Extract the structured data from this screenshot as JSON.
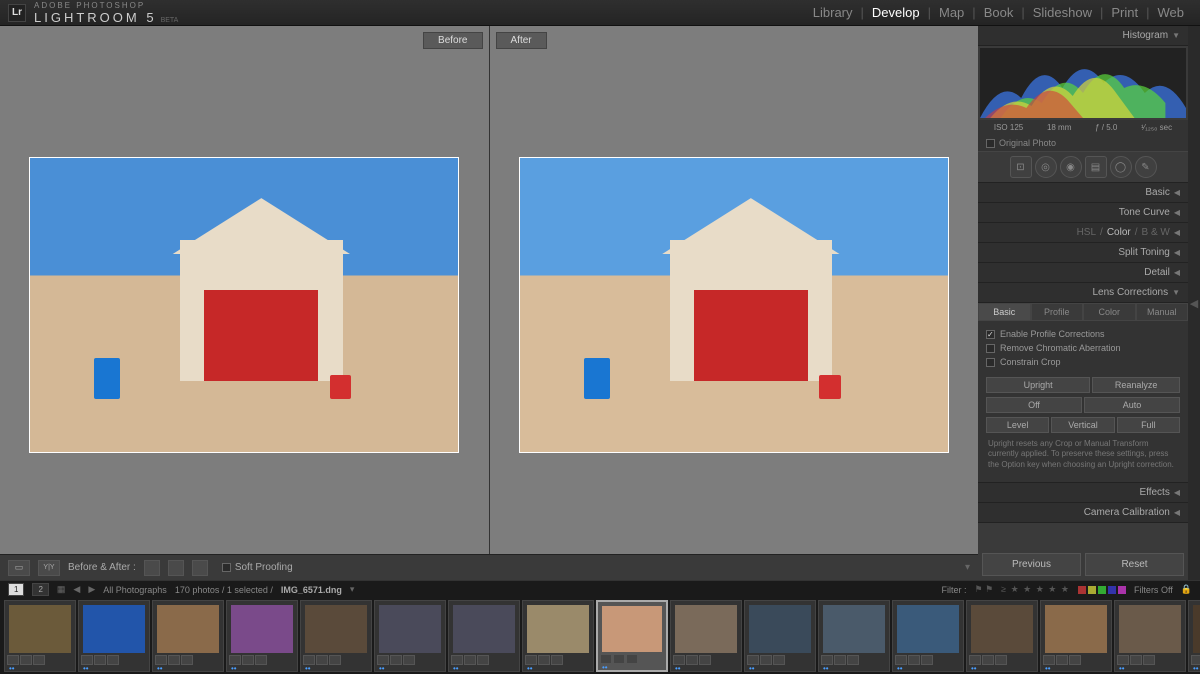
{
  "brand": {
    "small": "ADOBE PHOTOSHOP",
    "big": "LIGHTROOM 5",
    "beta": "BETA",
    "logo": "Lr"
  },
  "modules": [
    "Library",
    "Develop",
    "Map",
    "Book",
    "Slideshow",
    "Print",
    "Web"
  ],
  "active_module": "Develop",
  "compare": {
    "before": "Before",
    "after": "After"
  },
  "histogram": {
    "title": "Histogram",
    "iso": "ISO 125",
    "focal": "18 mm",
    "aperture": "ƒ / 5.0",
    "shutter": "¹⁄₁₂₅₀ sec",
    "original": "Original Photo"
  },
  "panels": {
    "basic": "Basic",
    "tone_curve": "Tone Curve",
    "hsl": {
      "hsl": "HSL",
      "color": "Color",
      "bw": "B & W"
    },
    "split_toning": "Split Toning",
    "detail": "Detail",
    "lens": "Lens Corrections",
    "effects": "Effects",
    "camera_cal": "Camera Calibration"
  },
  "lens": {
    "tabs": [
      "Basic",
      "Profile",
      "Color",
      "Manual"
    ],
    "active_tab": "Basic",
    "enable_profile": "Enable Profile Corrections",
    "remove_ca": "Remove Chromatic Aberration",
    "constrain": "Constrain Crop",
    "upright": "Upright",
    "reanalyze": "Reanalyze",
    "off": "Off",
    "auto": "Auto",
    "level": "Level",
    "vertical": "Vertical",
    "full": "Full",
    "help": "Upright resets any Crop or Manual Transform currently applied. To preserve these settings, press the Option key when choosing an Upright correction."
  },
  "bottom": {
    "previous": "Previous",
    "reset": "Reset"
  },
  "toolbar": {
    "ba": "Before & After :",
    "soft": "Soft Proofing"
  },
  "fs_header": {
    "pages": [
      "1",
      "2"
    ],
    "breadcrumb": "All Photographs",
    "count": "170 photos / 1 selected /",
    "file": "IMG_6571.dng",
    "filter_label": "Filter :",
    "filters_off": "Filters Off"
  },
  "thumbs": [
    {
      "c": "#6b5a3a"
    },
    {
      "c": "#2255aa"
    },
    {
      "c": "#8a6a4a"
    },
    {
      "c": "#7a4a8a"
    },
    {
      "c": "#5a4a3a"
    },
    {
      "c": "#4a4a5a"
    },
    {
      "c": "#4a4a5a"
    },
    {
      "c": "#9a8a6a"
    },
    {
      "c": "#c89878",
      "sel": true
    },
    {
      "c": "#7a6a5a"
    },
    {
      "c": "#3a4a5a"
    },
    {
      "c": "#4a5a6a"
    },
    {
      "c": "#3a5a7a"
    },
    {
      "c": "#5a4a3a"
    },
    {
      "c": "#8a6a4a"
    },
    {
      "c": "#6a5a4a"
    },
    {
      "c": "#4a3a2a"
    }
  ]
}
